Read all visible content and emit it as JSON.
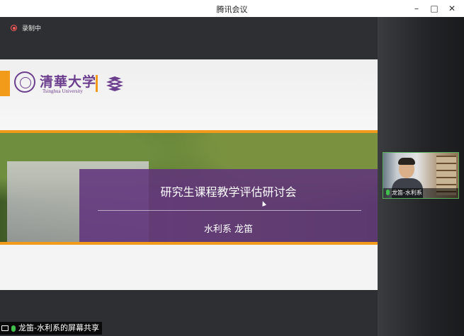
{
  "window": {
    "title": "腾讯会议",
    "controls": {
      "minimize": "–",
      "maximize": "□",
      "close": "✕"
    }
  },
  "recording": {
    "label": "录制中",
    "icon": "record-icon"
  },
  "slide": {
    "logo_cn": "清華大学",
    "logo_en": "Tsinghua University",
    "title": "研究生课程教学评估研讨会",
    "subtitle": "水利系 龙笛",
    "icons": {
      "seal": "university-seal-icon",
      "books": "books-icon"
    }
  },
  "participant": {
    "label": "龙笛-水利系",
    "mic_icon": "microphone-on-icon"
  },
  "share": {
    "label": "龙笛-水利系的屏幕共享"
  },
  "colors": {
    "accent_orange": "#f29a1a",
    "tsinghua_purple": "#6c3f8e",
    "mic_green": "#41c14b",
    "record_red": "#ff5a5a"
  }
}
